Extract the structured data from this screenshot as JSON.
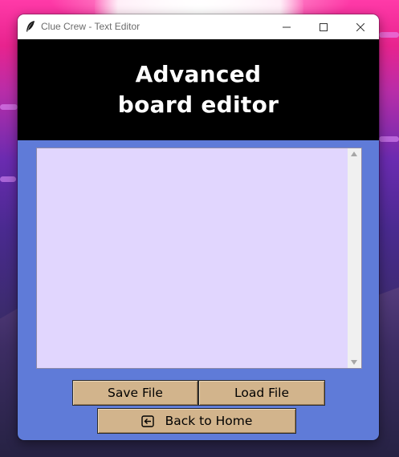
{
  "window": {
    "title": "Clue Crew - Text Editor",
    "controls": {
      "minimize": "minimize-icon",
      "maximize": "maximize-icon",
      "close": "close-icon"
    }
  },
  "header": {
    "title": "Advanced board editor"
  },
  "editor": {
    "value": "",
    "scrollbar": {
      "up": "scroll-up-arrow",
      "down": "scroll-down-arrow"
    }
  },
  "buttons": {
    "save": "Save File",
    "load": "Load File",
    "back": "Back to Home",
    "back_icon": "back-arrow-icon"
  },
  "colors": {
    "window_bg": "#5f7bd8",
    "header_bg": "#000000",
    "editor_bg": "#e1d6fe",
    "button_bg": "#d2b48c"
  }
}
